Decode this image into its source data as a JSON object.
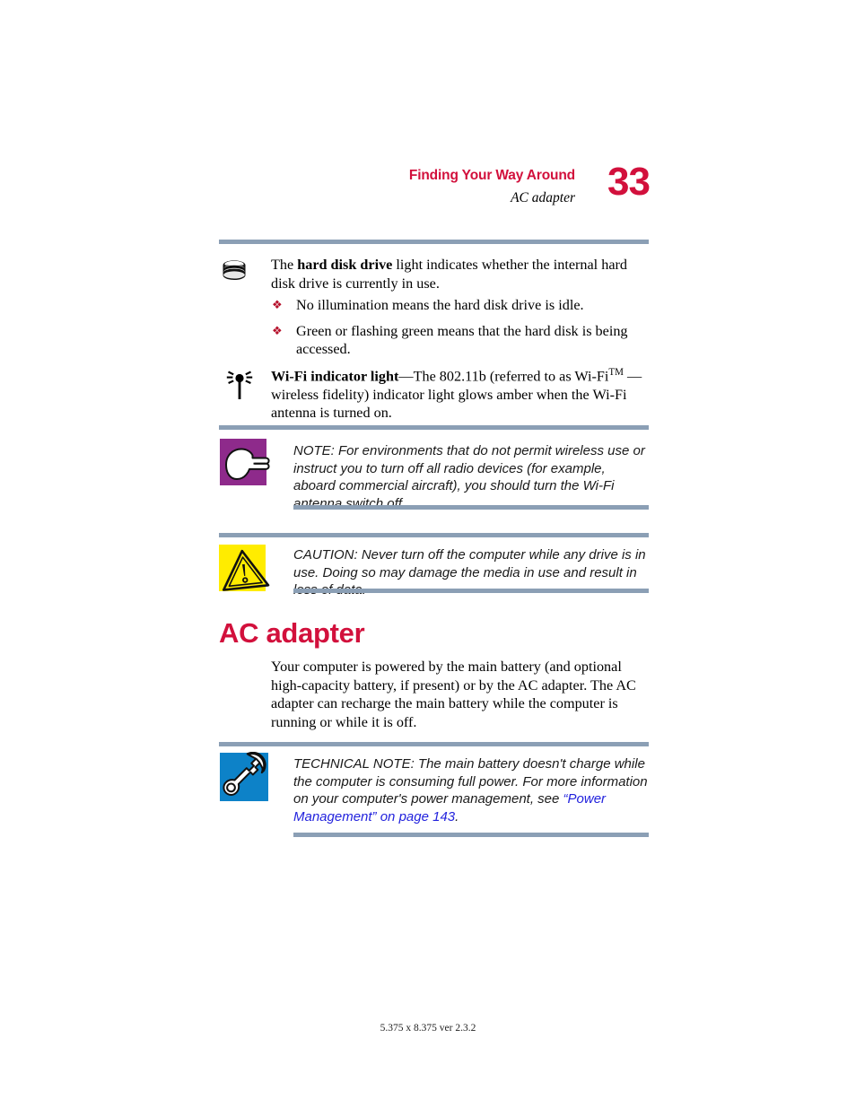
{
  "header": {
    "chapter": "Finding Your Way Around",
    "section": "AC adapter",
    "page_number": "33",
    "chapter_color": "#D2103C",
    "rule_color": "#8B9FB5"
  },
  "indicators": [
    {
      "icon": "hard-disk-drive-icon",
      "text_html": "The <b>hard disk drive</b> light indicates whether the internal hard disk drive is currently in use.",
      "text_plain": "The hard disk drive light indicates whether the internal hard disk drive is currently in use."
    },
    {
      "icon": "wifi-indicator-light-icon",
      "text_html": "<b>Wi-Fi indicator light</b>—The 802.11b (referred to as Wi-Fi<sup>TM</sup> — wireless fidelity) indicator light glows amber when the Wi-Fi antenna is turned on.",
      "text_plain": "Wi-Fi indicator light—The 802.11b (referred to as Wi-FiTM — wireless fidelity) indicator light glows amber when the Wi-Fi antenna is turned on."
    }
  ],
  "bullets": {
    "marker": "❖",
    "marker_color": "#B5112B",
    "items": [
      "No illumination means the hard disk drive is idle.",
      "Green or flashing green means that the hard disk is being accessed."
    ]
  },
  "callouts": {
    "note": {
      "icon": "pointing-hand-icon",
      "icon_bg": "#8E2A8B",
      "text": "NOTE: For environments that do not permit wireless use or instruct you to turn off all radio devices (for example, aboard commercial aircraft), you should turn the Wi-Fi antenna switch off."
    },
    "caution": {
      "icon": "warning-triangle-icon",
      "icon_bg": "#FFEC00",
      "text": "CAUTION: Never turn off the computer while any drive is in use. Doing so may damage the media in use and result in loss of data."
    },
    "technical_note": {
      "icon": "wrench-icon",
      "icon_bg": "#0D82C8",
      "text_before": "TECHNICAL NOTE: The main battery doesn't charge while the computer is consuming full power. For more information on your computer's power management, see ",
      "link_text": "“Power Management” on page 143",
      "link_color": "#2222DD",
      "text_after": "."
    }
  },
  "section": {
    "heading": "AC adapter",
    "paragraph": "Your computer is powered by the main battery (and optional high-capacity battery, if present) or by the AC adapter. The AC adapter can recharge the main battery while the computer is running or while it is off."
  },
  "footer": {
    "text": "5.375 x 8.375 ver 2.3.2"
  }
}
